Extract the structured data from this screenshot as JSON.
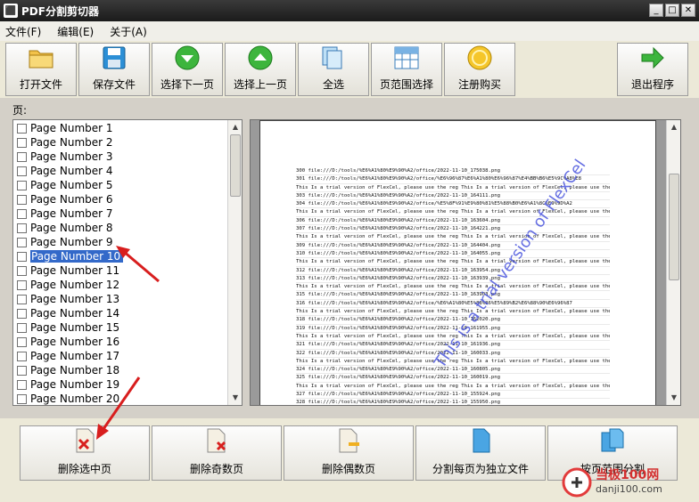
{
  "window": {
    "title": "PDF分割剪切器"
  },
  "menu": [
    "文件(F)",
    "编辑(E)",
    "关于(A)"
  ],
  "toolbar": [
    {
      "label": "打开文件",
      "icon": "folder-icon"
    },
    {
      "label": "保存文件",
      "icon": "floppy-icon"
    },
    {
      "label": "选择下一页",
      "icon": "down-arrow-icon"
    },
    {
      "label": "选择上一页",
      "icon": "up-arrow-icon"
    },
    {
      "label": "全选",
      "icon": "stack-icon"
    },
    {
      "label": "页范围选择",
      "icon": "grid-icon"
    },
    {
      "label": "注册购买",
      "icon": "coin-icon"
    },
    {
      "label": "退出程序",
      "icon": "exit-arrow-icon"
    }
  ],
  "pages_label": "页:",
  "pages": [
    "Page Number 1",
    "Page Number 2",
    "Page Number 3",
    "Page Number 4",
    "Page Number 5",
    "Page Number 6",
    "Page Number 7",
    "Page Number 8",
    "Page Number 9",
    "Page Number 10",
    "Page Number 11",
    "Page Number 12",
    "Page Number 13",
    "Page Number 14",
    "Page Number 15",
    "Page Number 16",
    "Page Number 17",
    "Page Number 18",
    "Page Number 19",
    "Page Number 20"
  ],
  "selected_page_index": 9,
  "preview_lines": [
    "300   file:///D:/tools/%E6%A1%80%E9%90%A2/office/2022-11-10_175038.png",
    "301   file:///D:/tools/%E6%A1%80%E9%90%A2/office/%E6%96%87%E6%A1%80%E6%96%87%E4%BB%B6%E5%9C%A8%E8",
    "This Is a trial version of FlexCel, please use the reg This Is a trial version of FlexCel, please use the reg",
    "303   file:///D:/tools/%E6%A1%80%E9%90%A2/office/2022-11-10_164111.png",
    "304   file:///D:/tools/%E6%A1%80%E9%90%A2/office/%E5%8F%91%E9%80%81%E5%88%B0%E6%A1%8C%E9%9D%A2",
    "This Is a trial version of FlexCel, please use the reg This Is a trial version of FlexCel, please use the reg",
    "306   file:///D:/tools/%E6%A1%80%E9%90%A2/office/2022-11-10_163604.png",
    "307   file:///D:/tools/%E6%A1%80%E9%90%A2/office/2022-11-10_164221.png",
    "This Is a trial version of FlexCel, please use the reg This Is a trial version of FlexCel, please use the reg",
    "309   file:///D:/tools/%E6%A1%80%E9%90%A2/office/2022-11-10_164404.png",
    "310   file:///D:/tools/%E6%A1%80%E9%90%A2/office/2022-11-10_164055.png",
    "This Is a trial version of FlexCel, please use the reg This Is a trial version of FlexCel, please use the reg",
    "312   file:///D:/tools/%E6%A1%80%E9%90%A2/office/2022-11-10_163954.png",
    "313   file:///D:/tools/%E6%A1%80%E9%90%A2/office/2022-11-10_163939.png",
    "This Is a trial version of FlexCel, please use the reg This Is a trial version of FlexCel, please use the reg",
    "315   file:///D:/tools/%E6%A1%80%E9%90%A2/office/2022-11-10_163903.png",
    "316   file:///D:/tools/%E6%A1%80%E9%90%A2/office/%E6%A1%80%E5%88%86%E5%89%B2%E6%88%90%E6%96%87",
    "This Is a trial version of FlexCel, please use the reg This Is a trial version of FlexCel, please use the reg",
    "318   file:///D:/tools/%E6%A1%80%E9%90%A2/office/2022-11-10_162020.png",
    "319   file:///D:/tools/%E6%A1%80%E9%90%A2/office/2022-11-10_161955.png",
    "This Is a trial version of FlexCel, please use the reg This Is a trial version of FlexCel, please use the reg",
    "321   file:///D:/tools/%E6%A1%80%E9%90%A2/office/2022-11-10_161936.png",
    "322   file:///D:/tools/%E6%A1%80%E9%90%A2/office/2022-11-10_160033.png",
    "This Is a trial version of FlexCel, please use the reg This Is a trial version of FlexCel, please use the reg",
    "324   file:///D:/tools/%E6%A1%80%E9%90%A2/office/2022-11-10_160805.png",
    "325   file:///D:/tools/%E6%A1%80%E9%90%A2/office/2022-11-10_160019.png",
    "This Is a trial version of FlexCel, please use the reg This Is a trial version of FlexCel, please use the reg",
    "327   file:///D:/tools/%E6%A1%80%E9%90%A2/office/2022-11-10_155924.png",
    "328   file:///D:/tools/%E6%A1%80%E9%90%A2/office/2022-11-10_155950.png"
  ],
  "preview_watermark": "This is a trial version of FlexCel",
  "bottom_buttons": [
    {
      "label": "删除选中页",
      "icon": "delete-page-icon"
    },
    {
      "label": "删除奇数页",
      "icon": "delete-odd-icon"
    },
    {
      "label": "删除偶数页",
      "icon": "delete-even-icon"
    },
    {
      "label": "分割每页为独立文件",
      "icon": "split-icon"
    },
    {
      "label": "按页范围分割",
      "icon": "range-split-icon"
    }
  ],
  "site_badge": {
    "name": "当极100网",
    "url": "danji100.com"
  },
  "colors": {
    "selected": "#3369c9",
    "titlebar": "#1b1b1b",
    "arrow": "#d81e1e"
  }
}
